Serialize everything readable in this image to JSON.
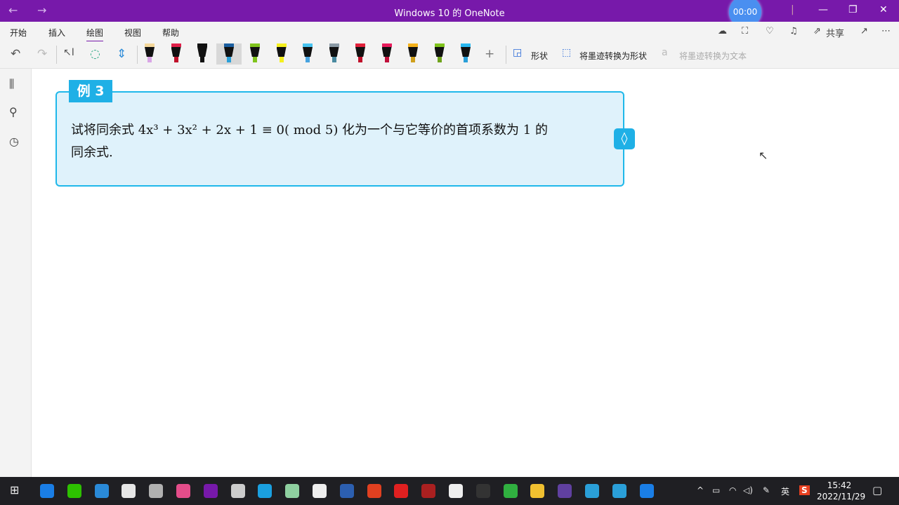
{
  "window": {
    "title": "Windows 10 的 OneNote",
    "timer": "00:00",
    "back": "←",
    "forward": "→",
    "minimize": "—",
    "restore": "❐",
    "close": "✕"
  },
  "menu": {
    "tabs": [
      "开始",
      "插入",
      "绘图",
      "视图",
      "帮助"
    ],
    "active": "绘图",
    "share": "共享"
  },
  "toolbar": {
    "shapes": "形状",
    "ink_to_shape": "将墨迹转换为形状",
    "ink_to_text": "将墨迹转换为文本",
    "pens": [
      {
        "cap": "#f4d79a",
        "tip": "#d9a6e6"
      },
      {
        "cap": "#e0204a",
        "tip": "#c0102a"
      },
      {
        "cap": "#111111",
        "tip": "#111111"
      },
      {
        "cap": "#1b5fa0",
        "tip": "#2a9fd8"
      },
      {
        "cap": "#7fc31c",
        "tip": "#7fc31c"
      },
      {
        "cap": "#f5f01f",
        "tip": "#f5f01f"
      },
      {
        "cap": "#47c3f0",
        "tip": "#47a3e0"
      },
      {
        "cap": "#8a9aa5",
        "tip": "#4a8aa0"
      },
      {
        "cap": "#e0203a",
        "tip": "#c0102a"
      },
      {
        "cap": "#e81c5c",
        "tip": "#c0103a"
      },
      {
        "cap": "#f5b21c",
        "tip": "#d0a01c"
      },
      {
        "cap": "#7fc31c",
        "tip": "#6fa31c"
      },
      {
        "cap": "#2ab8f0",
        "tip": "#2a9fd8"
      }
    ]
  },
  "note": {
    "label": "例 3",
    "text_line1": "试将同余式 4x³ + 3x² + 2x + 1 ≡ 0(  mod 5) 化为一个与它等价的首项系数为 1 的",
    "text_line2": "同余式.",
    "handle": "◊"
  },
  "taskbar": {
    "time": "15:42",
    "date": "2022/11/29",
    "ime": "英",
    "apps": [
      "#1a7ee6",
      "#2dc100",
      "#2a8ad8",
      "#e6e6e6",
      "#b0b0b0",
      "#e44d8a",
      "#7719aa",
      "#cccccc",
      "#1aa0e0",
      "#8fd0a0",
      "#eeeeee",
      "#2c5fb0",
      "#e04020",
      "#e02020",
      "#aa2020",
      "#eeeeee",
      "#333333",
      "#30b040",
      "#f0c030",
      "#6040a0",
      "#2a9fd8",
      "#2a9fd8",
      "#1a7ee6"
    ]
  },
  "colors": {
    "accent": "#7719aa",
    "note_border": "#1fb8ea",
    "note_bg": "#dff2fb"
  }
}
